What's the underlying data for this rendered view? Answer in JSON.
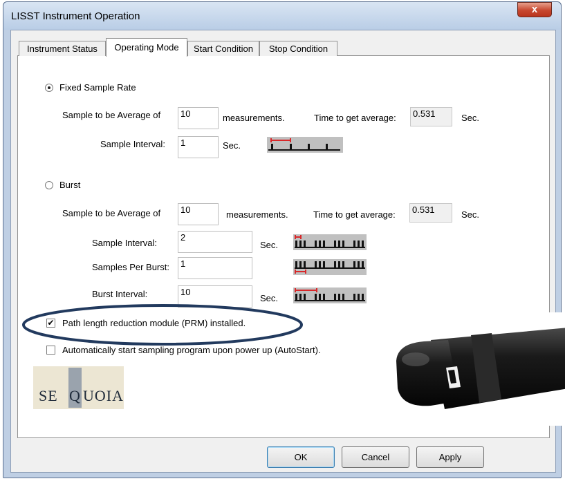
{
  "window": {
    "title": "LISST Instrument Operation",
    "close_glyph": "x"
  },
  "tabs": [
    {
      "label": "Instrument Status"
    },
    {
      "label": "Operating Mode"
    },
    {
      "label": "Start Condition"
    },
    {
      "label": "Stop Condition"
    }
  ],
  "fixed": {
    "radio_label": "Fixed Sample Rate",
    "avg_label": "Sample to be Average of",
    "avg_value": "10",
    "measurements_label": "measurements.",
    "time_label": "Time to get average:",
    "time_value": "0.531",
    "sec_label": "Sec.",
    "interval_label": "Sample Interval:",
    "interval_value": "1",
    "interval_unit": "Sec."
  },
  "burst": {
    "radio_label": "Burst",
    "avg_label": "Sample to be Average of",
    "avg_value": "10",
    "measurements_label": "measurements.",
    "time_label": "Time to get average:",
    "time_value": "0.531",
    "sec_label": "Sec.",
    "interval_label": "Sample Interval:",
    "interval_value": "2",
    "interval_unit": "Sec.",
    "per_burst_label": "Samples Per Burst:",
    "per_burst_value": "1",
    "burst_interval_label": "Burst Interval:",
    "burst_interval_value": "10",
    "burst_interval_unit": "Sec."
  },
  "options": {
    "prm_label": "Path length reduction module (PRM) installed.",
    "prm_checked": true,
    "autostart_label": "Automatically start sampling program upon power up (AutoStart).",
    "autostart_checked": false
  },
  "logo": {
    "text_left": "SE",
    "text_q": "Q",
    "text_right": "UOIA"
  },
  "buttons": {
    "ok": "OK",
    "cancel": "Cancel",
    "apply": "Apply"
  },
  "colors": {
    "highlight_ellipse": "#223a5e",
    "diagram_marker": "#d8282a"
  }
}
